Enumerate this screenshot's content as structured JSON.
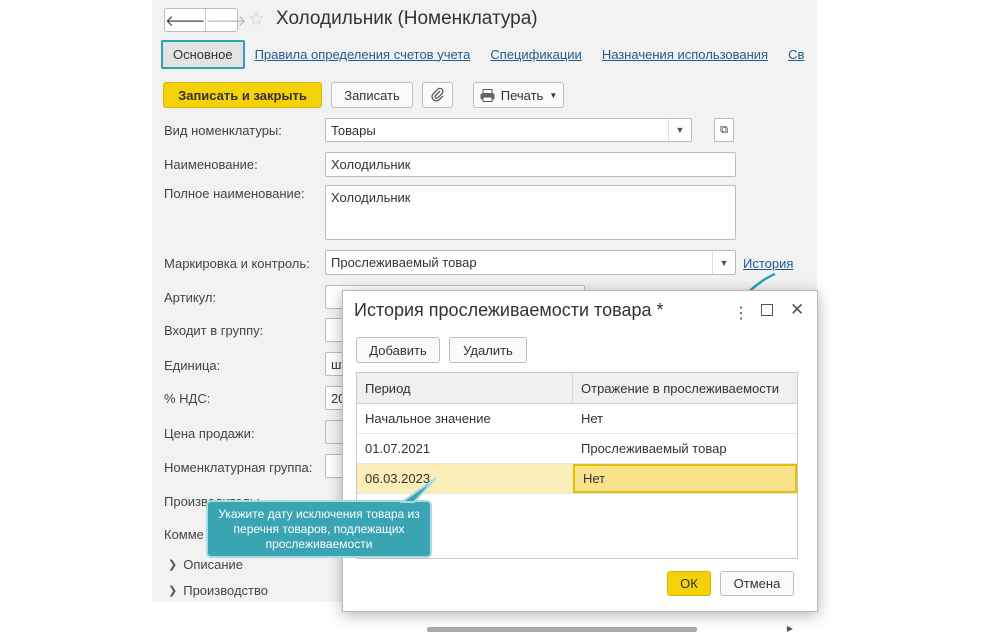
{
  "window": {
    "title": "Холодильник (Номенклатура)"
  },
  "nav": {
    "back_glyph": "🡐",
    "forward_glyph": "🡒",
    "star_glyph": "☆"
  },
  "tabs": [
    {
      "label": "Основное",
      "active": true
    },
    {
      "label": "Правила определения счетов учета"
    },
    {
      "label": "Спецификации"
    },
    {
      "label": "Назначения использования"
    },
    {
      "label": "Св"
    }
  ],
  "toolbar": {
    "save_close_label": "Записать и закрыть",
    "save_label": "Записать",
    "print_label": "Печать",
    "attach_icon": "paperclip-icon",
    "print_icon": "printer-icon"
  },
  "form": {
    "kind_label": "Вид номенклатуры:",
    "kind_value": "Товары",
    "name_label": "Наименование:",
    "name_value": "Холодильник",
    "fullname_label": "Полное наименование:",
    "fullname_value": "Холодильник",
    "marking_label": "Маркировка и контроль:",
    "marking_value": "Прослеживаемый товар",
    "history_link": "История",
    "article_label": "Артикул:",
    "group_label": "Входит в группу:",
    "unit_label": "Единица:",
    "unit_value_partial": "шт",
    "vat_label": "% НДС:",
    "vat_value_partial": "20",
    "price_label": "Цена продажи:",
    "nomgroup_label": "Номенклатурная группа:",
    "maker_label": "Производитель:",
    "comment_label": "Комме",
    "section_description": "Описание",
    "section_production": "Производство"
  },
  "dialog": {
    "title": "История прослеживаемости товара *",
    "add_label": "Добавить",
    "delete_label": "Удалить",
    "columns": [
      "Период",
      "Отражение в прослеживаемости"
    ],
    "rows": [
      [
        "Начальное значение",
        "Нет"
      ],
      [
        "01.07.2021",
        "Прослеживаемый товар"
      ],
      [
        "06.03.2023",
        "Нет"
      ]
    ],
    "ok_label": "ОК",
    "cancel_label": "Отмена"
  },
  "callout": {
    "text": "Укажите дату исключения товара из перечня товаров, подлежащих прослеживаемости"
  },
  "colors": {
    "accent": "#2aa2b0",
    "primary_button": "#f5d10a",
    "link": "#1f5b8f",
    "selected_row": "#fbeeb8"
  }
}
